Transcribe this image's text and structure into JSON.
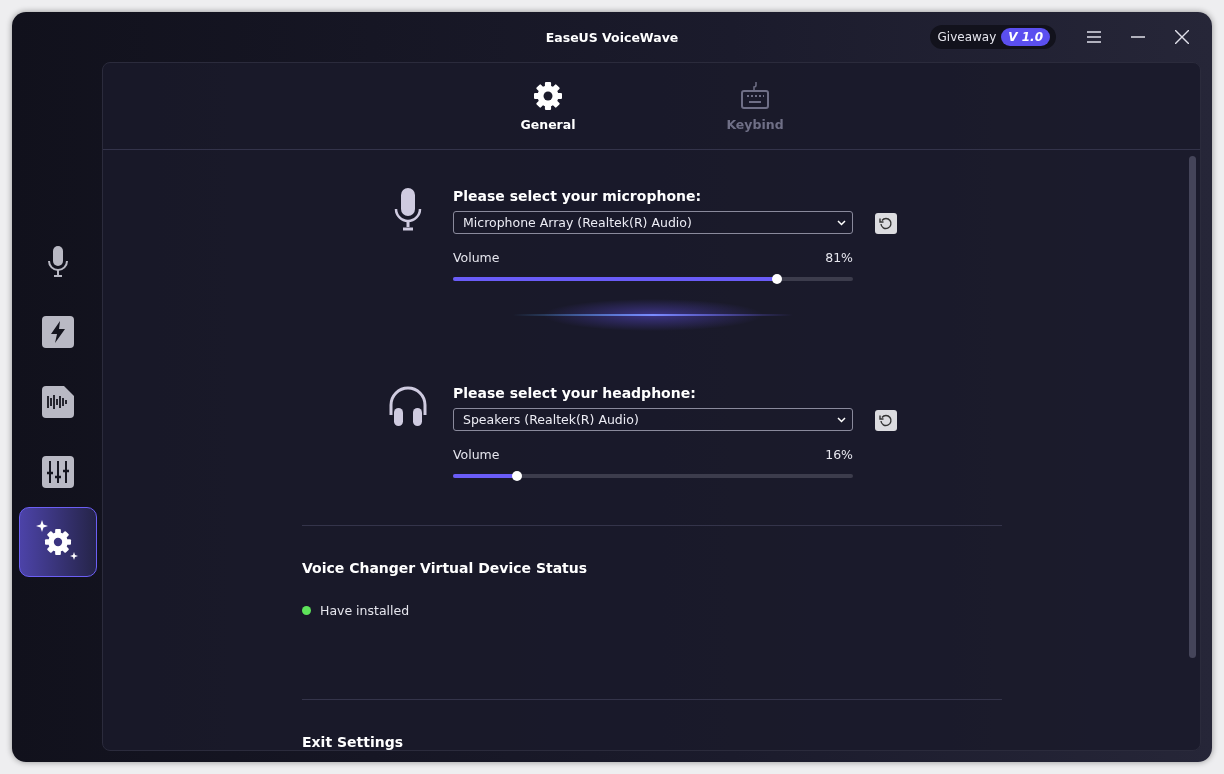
{
  "window": {
    "title": "EaseUS VoiceWave",
    "giveaway": {
      "label": "Giveaway",
      "version": "V 1.0"
    }
  },
  "sidebar": {
    "items": [
      {
        "kind": "microphone",
        "selected": false
      },
      {
        "kind": "lightning",
        "selected": false
      },
      {
        "kind": "waveform",
        "selected": false
      },
      {
        "kind": "mixer",
        "selected": false
      },
      {
        "kind": "settings",
        "selected": true
      }
    ]
  },
  "tabs": [
    {
      "kind": "gear",
      "label": "General",
      "selected": true
    },
    {
      "kind": "keyboard",
      "label": "Keybind",
      "selected": false
    }
  ],
  "devices": [
    {
      "kind": "microphone",
      "heading": "Please select your microphone:",
      "value": "Microphone Array (Realtek(R) Audio)",
      "volume_label": "Volume",
      "reading": "81%",
      "level": 0.81
    },
    {
      "kind": "headphone",
      "heading": "Please select your headphone:",
      "value": "Speakers (Realtek(R) Audio)",
      "volume_label": "Volume",
      "reading": "16%",
      "level": 0.16
    }
  ],
  "virtual_device": {
    "heading": "Voice Changer Virtual Device Status",
    "status": "Have installed",
    "color": "#5ee35a"
  },
  "exit_settings": {
    "heading": "Exit Settings"
  }
}
